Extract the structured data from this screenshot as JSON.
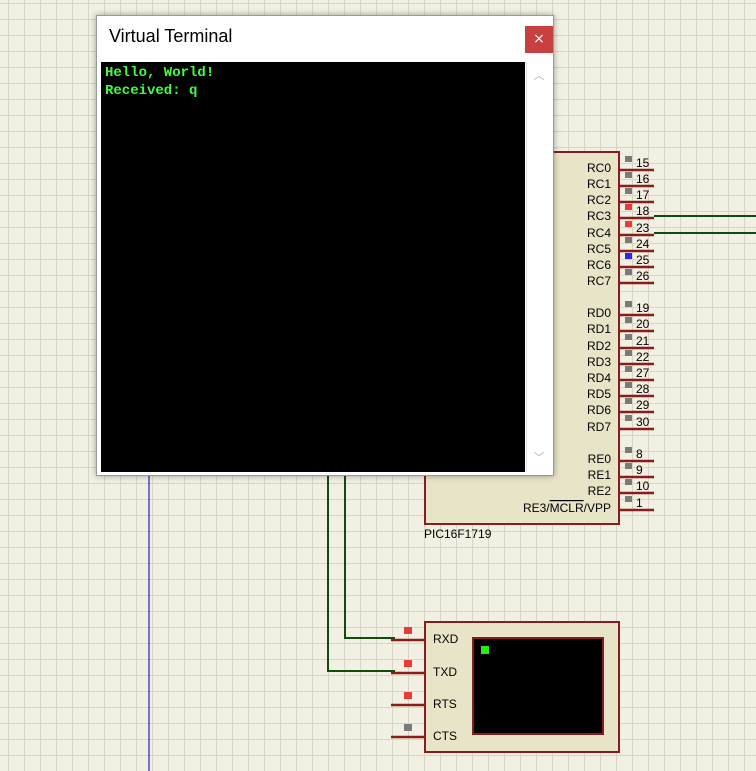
{
  "terminal_window": {
    "title": "Virtual Terminal",
    "close_glyph": "×",
    "lines": [
      "Hello, World!",
      "Received: q"
    ]
  },
  "mcu": {
    "part_name": "PIC16F1719",
    "pins": [
      {
        "label": "RC0",
        "num": "15",
        "state": "gray"
      },
      {
        "label": "RC1",
        "num": "16",
        "state": "gray"
      },
      {
        "label": "RC2",
        "num": "17",
        "state": "gray"
      },
      {
        "label": "RC3",
        "num": "18",
        "state": "red"
      },
      {
        "label": "RC4",
        "num": "23",
        "state": "red"
      },
      {
        "label": "RC5",
        "num": "24",
        "state": "gray"
      },
      {
        "label": "RC6",
        "num": "25",
        "state": "blue"
      },
      {
        "label": "RC7",
        "num": "26",
        "state": "gray"
      },
      {
        "label": "RD0",
        "num": "19",
        "state": "gray"
      },
      {
        "label": "RD1",
        "num": "20",
        "state": "gray"
      },
      {
        "label": "RD2",
        "num": "21",
        "state": "gray"
      },
      {
        "label": "RD3",
        "num": "22",
        "state": "gray"
      },
      {
        "label": "RD4",
        "num": "27",
        "state": "gray"
      },
      {
        "label": "RD5",
        "num": "28",
        "state": "gray"
      },
      {
        "label": "RD6",
        "num": "29",
        "state": "gray"
      },
      {
        "label": "RD7",
        "num": "30",
        "state": "gray"
      },
      {
        "label": "RE0",
        "num": "8",
        "state": "gray"
      },
      {
        "label": "RE1",
        "num": "9",
        "state": "gray"
      },
      {
        "label": "RE2",
        "num": "10",
        "state": "gray"
      },
      {
        "label": "RE3/MCLR/VPP",
        "num": "1",
        "state": "gray"
      }
    ],
    "mclr_prefix": "RE3/",
    "mclr_overbar": "MCLR",
    "mclr_suffix": "/VPP"
  },
  "terminal_component": {
    "pins": [
      {
        "label": "RXD",
        "state": "red"
      },
      {
        "label": "TXD",
        "state": "red"
      },
      {
        "label": "RTS",
        "state": "red"
      },
      {
        "label": "CTS",
        "state": "gray"
      }
    ]
  },
  "colors": {
    "part_outline": "#8b1c1c",
    "part_fill": "#e8e4c8",
    "wire_green": "#0f4d0f",
    "wire_blue": "#2323c8",
    "pin_red": "#e83c3c",
    "pin_gray": "#7a7a7a",
    "pin_blue": "#2a2ae6",
    "terminal_text": "#3cff3c"
  }
}
